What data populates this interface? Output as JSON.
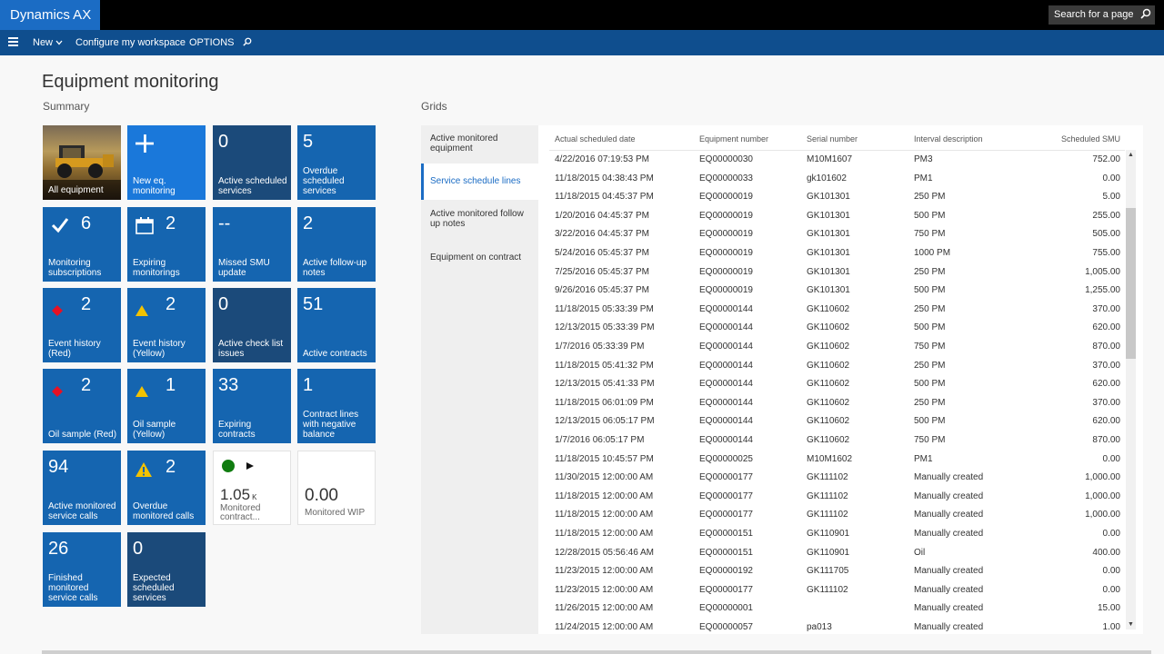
{
  "topbar": {
    "brand": "Dynamics AX",
    "search_placeholder": "Search for a page"
  },
  "actionbar": {
    "new_label": "New",
    "configure_label": "Configure my workspace",
    "options_label": "OPTIONS"
  },
  "page": {
    "title": "Equipment monitoring",
    "summary_label": "Summary",
    "grids_label": "Grids"
  },
  "tiles": [
    {
      "label": "All equipment",
      "count": ""
    },
    {
      "label": "New eq. monitoring",
      "count": ""
    },
    {
      "label": "Active scheduled services",
      "count": "0"
    },
    {
      "label": "Overdue scheduled services",
      "count": "5"
    },
    {
      "label": "Monitoring subscriptions",
      "count": "6"
    },
    {
      "label": "Expiring monitorings",
      "count": "2"
    },
    {
      "label": "Missed SMU update",
      "count": "--"
    },
    {
      "label": "Active follow-up notes",
      "count": "2"
    },
    {
      "label": "Event history (Red)",
      "count": "2"
    },
    {
      "label": "Event history (Yellow)",
      "count": "2"
    },
    {
      "label": "Active check list issues",
      "count": "0"
    },
    {
      "label": "Active contracts",
      "count": "51"
    },
    {
      "label": "Oil sample (Red)",
      "count": "2"
    },
    {
      "label": "Oil sample (Yellow)",
      "count": "1"
    },
    {
      "label": "Expiring contracts",
      "count": "33"
    },
    {
      "label": "Contract lines with negative balance",
      "count": "1"
    },
    {
      "label": "Active monitored service calls",
      "count": "94"
    },
    {
      "label": "Overdue monitored calls",
      "count": "2"
    },
    {
      "label": "Monitored contract...",
      "count": "1.05",
      "unit": "K"
    },
    {
      "label": "Monitored WIP",
      "count": "0.00"
    },
    {
      "label": "Finished monitored service calls",
      "count": "26"
    },
    {
      "label": "Expected scheduled services",
      "count": "0"
    }
  ],
  "grid_nav": [
    {
      "label": "Active monitored equipment",
      "active": false
    },
    {
      "label": "Service schedule lines",
      "active": true
    },
    {
      "label": "Active monitored follow up notes",
      "active": false
    },
    {
      "label": "Equipment on contract",
      "active": false
    }
  ],
  "grid": {
    "columns": [
      "Actual scheduled date",
      "Equipment number",
      "Serial number",
      "Interval description",
      "Scheduled SMU"
    ],
    "rows": [
      [
        "4/22/2016 07:19:53 PM",
        "EQ00000030",
        "M10M1607",
        "PM3",
        "752.00"
      ],
      [
        "11/18/2015 04:38:43 PM",
        "EQ00000033",
        "gk101602",
        "PM1",
        "0.00"
      ],
      [
        "11/18/2015 04:45:37 PM",
        "EQ00000019",
        "GK101301",
        "250 PM",
        "5.00"
      ],
      [
        "1/20/2016 04:45:37 PM",
        "EQ00000019",
        "GK101301",
        "500 PM",
        "255.00"
      ],
      [
        "3/22/2016 04:45:37 PM",
        "EQ00000019",
        "GK101301",
        "750 PM",
        "505.00"
      ],
      [
        "5/24/2016 05:45:37 PM",
        "EQ00000019",
        "GK101301",
        "1000 PM",
        "755.00"
      ],
      [
        "7/25/2016 05:45:37 PM",
        "EQ00000019",
        "GK101301",
        "250 PM",
        "1,005.00"
      ],
      [
        "9/26/2016 05:45:37 PM",
        "EQ00000019",
        "GK101301",
        "500 PM",
        "1,255.00"
      ],
      [
        "11/18/2015 05:33:39 PM",
        "EQ00000144",
        "GK110602",
        "250 PM",
        "370.00"
      ],
      [
        "12/13/2015 05:33:39 PM",
        "EQ00000144",
        "GK110602",
        "500 PM",
        "620.00"
      ],
      [
        "1/7/2016 05:33:39 PM",
        "EQ00000144",
        "GK110602",
        "750 PM",
        "870.00"
      ],
      [
        "11/18/2015 05:41:32 PM",
        "EQ00000144",
        "GK110602",
        "250 PM",
        "370.00"
      ],
      [
        "12/13/2015 05:41:33 PM",
        "EQ00000144",
        "GK110602",
        "500 PM",
        "620.00"
      ],
      [
        "11/18/2015 06:01:09 PM",
        "EQ00000144",
        "GK110602",
        "250 PM",
        "370.00"
      ],
      [
        "12/13/2015 06:05:17 PM",
        "EQ00000144",
        "GK110602",
        "500 PM",
        "620.00"
      ],
      [
        "1/7/2016 06:05:17 PM",
        "EQ00000144",
        "GK110602",
        "750 PM",
        "870.00"
      ],
      [
        "11/18/2015 10:45:57 PM",
        "EQ00000025",
        "M10M1602",
        "PM1",
        "0.00"
      ],
      [
        "11/30/2015 12:00:00 AM",
        "EQ00000177",
        "GK111102",
        "Manually created",
        "1,000.00"
      ],
      [
        "11/18/2015 12:00:00 AM",
        "EQ00000177",
        "GK111102",
        "Manually created",
        "1,000.00"
      ],
      [
        "11/18/2015 12:00:00 AM",
        "EQ00000177",
        "GK111102",
        "Manually created",
        "1,000.00"
      ],
      [
        "11/18/2015 12:00:00 AM",
        "EQ00000151",
        "GK110901",
        "Manually created",
        "0.00"
      ],
      [
        "12/28/2015 05:56:46 AM",
        "EQ00000151",
        "GK110901",
        "Oil",
        "400.00"
      ],
      [
        "11/23/2015 12:00:00 AM",
        "EQ00000192",
        "GK111705",
        "Manually created",
        "0.00"
      ],
      [
        "11/23/2015 12:00:00 AM",
        "EQ00000177",
        "GK111102",
        "Manually created",
        "0.00"
      ],
      [
        "11/26/2015 12:00:00 AM",
        "EQ00000001",
        "",
        "Manually created",
        "15.00"
      ],
      [
        "11/24/2015 12:00:00 AM",
        "EQ00000057",
        "pa013",
        "Manually created",
        "1.00"
      ]
    ]
  },
  "colors": {
    "brand": "#1b6cc4",
    "actionbar": "#0f4e8e",
    "tile": "#1565b0",
    "tile_dark": "#1b4a7a",
    "red": "#e81123",
    "yellow": "#f2c200",
    "green": "#107c10"
  }
}
